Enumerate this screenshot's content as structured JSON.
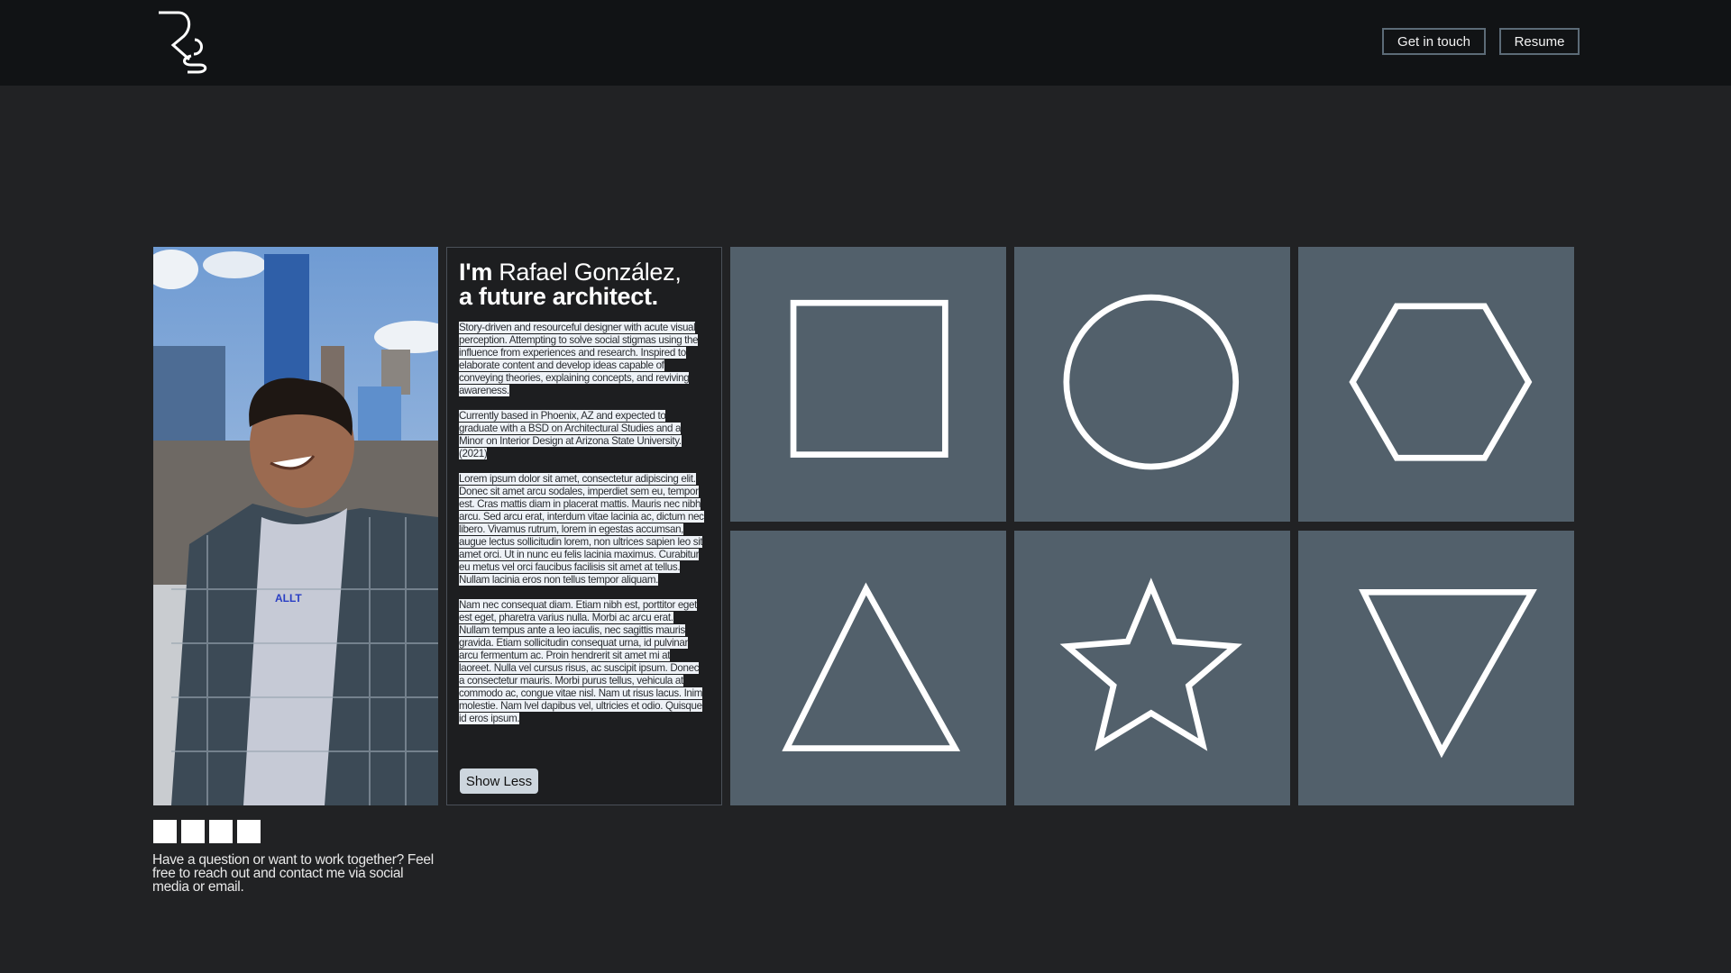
{
  "header": {
    "logo_text": "Rg",
    "buttons": [
      {
        "label": "Get in touch"
      },
      {
        "label": "Resume"
      }
    ]
  },
  "intro": {
    "greeting": "I'm",
    "name": "Rafael González,",
    "tagline": "a future architect.",
    "paragraphs": [
      "Story-driven and resourceful designer with acute visual perception. Attempting to solve social stigmas using the influence from experiences and research. Inspired to elaborate content and develop ideas capable of conveying theories, explaining concepts, and reviving awareness.",
      "Currently based in Phoenix, AZ and expected to graduate with a BSD on Architectural Studies and a Minor on Interior Design at Arizona State University. (2021)",
      "Lorem ipsum dolor sit amet, consectetur adipiscing elit. Donec sit amet arcu sodales, imperdiet sem eu, tempor est. Cras mattis diam in placerat mattis. Mauris nec nibh arcu. Sed arcu erat, interdum vitae lacinia ac, dictum nec libero. Vivamus rutrum, lorem in egestas accumsan, augue lectus sollicitudin lorem, non ultrices sapien leo sit amet orci. Ut in nunc eu felis lacinia maximus. Curabitur eu metus vel orci faucibus facilisis sit amet at tellus. Nullam lacinia eros non tellus tempor aliquam.",
      "Nam nec consequat diam. Etiam nibh est, porttitor eget est eget, pharetra varius nulla. Morbi ac arcu erat. Nullam tempus ante a leo iaculis, nec sagittis mauris gravida. Etiam sollicitudin consequat urna, id pulvinar arcu fermentum ac. Proin hendrerit sit amet mi at laoreet. Nulla vel cursus risus, ac suscipit ipsum. Donec a consectetur mauris. Morbi purus tellus, vehicula at commodo ac, congue vitae nisl. Nam ut risus lacus. Inim molestie. Nam lvel dapibus vel, ultricies et odio. Quisque id eros ipsum."
    ],
    "toggle_label": "Show Less"
  },
  "photo": {
    "hoodie_text": "ALLT"
  },
  "tiles": [
    "square",
    "circle",
    "hexagon",
    "triangle",
    "star",
    "inverted-triangle"
  ],
  "colors": {
    "header_bg": "#111315",
    "page_bg": "#212224",
    "tile_bg": "#52606b",
    "button_border": "#5c6b77"
  },
  "social_icons": [
    "social-link-1",
    "social-link-2",
    "social-link-3",
    "social-link-4"
  ],
  "contact": {
    "text": "Have a question or want to work together? Feel free to reach out and contact me via social media or email."
  }
}
